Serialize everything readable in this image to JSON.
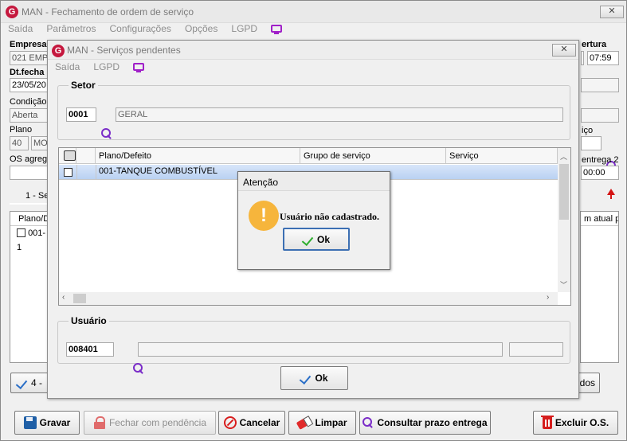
{
  "main": {
    "title": "MAN - Fechamento de ordem de serviço",
    "close_label": "✕",
    "menu": [
      "Saída",
      "Parâmetros",
      "Configurações",
      "Opções",
      "LGPD"
    ],
    "empresa_label": "Empresa",
    "empresa_value": "021 EMP",
    "dtfecha_label": "Dt.fecha",
    "dtfecha_value": "23/05/20",
    "condicao_label": "Condição",
    "condicao_value": "Aberta",
    "plano_label": "Plano",
    "plano_code": "40",
    "plano_name": "MO",
    "os_agregada_label": "OS agrega",
    "tab_1_label": "1 - Se",
    "list_header": "Plano/D",
    "list_item": "001-1",
    "abertura_label": "ertura",
    "abertura_time": "07:59",
    "servico_label": "iço",
    "entrega_label": "entrega 2",
    "entrega_value": "00:00",
    "m_atual_label": "m atual pl",
    "todos_label": "dos",
    "btn_4_label": "4 -",
    "buttons": {
      "gravar": "Gravar",
      "fechar_pendencia": "Fechar com pendência",
      "cancelar": "Cancelar",
      "limpar": "Limpar",
      "consultar": "Consultar prazo entrega",
      "excluir": "Excluir O.S."
    }
  },
  "servicos": {
    "title": "MAN - Serviços pendentes",
    "close_label": "✕",
    "menu": [
      "Saída",
      "LGPD"
    ],
    "setor_group": "Setor",
    "setor_code": "0001",
    "setor_name": "GERAL",
    "columns": [
      "Plano/Defeito",
      "Grupo de serviço",
      "Serviço"
    ],
    "rows": [
      {
        "plano": "001-TANQUE COMBUSTÍVEL",
        "grupo": "",
        "servico": "",
        "checked": false
      }
    ],
    "usuario_group": "Usuário",
    "usuario_code": "008401",
    "usuario_name": "",
    "ok_label": "Ok"
  },
  "atencao": {
    "title": "Atenção",
    "icon": "!",
    "message": "Usuário não cadastrado.",
    "ok_label": "Ok"
  }
}
